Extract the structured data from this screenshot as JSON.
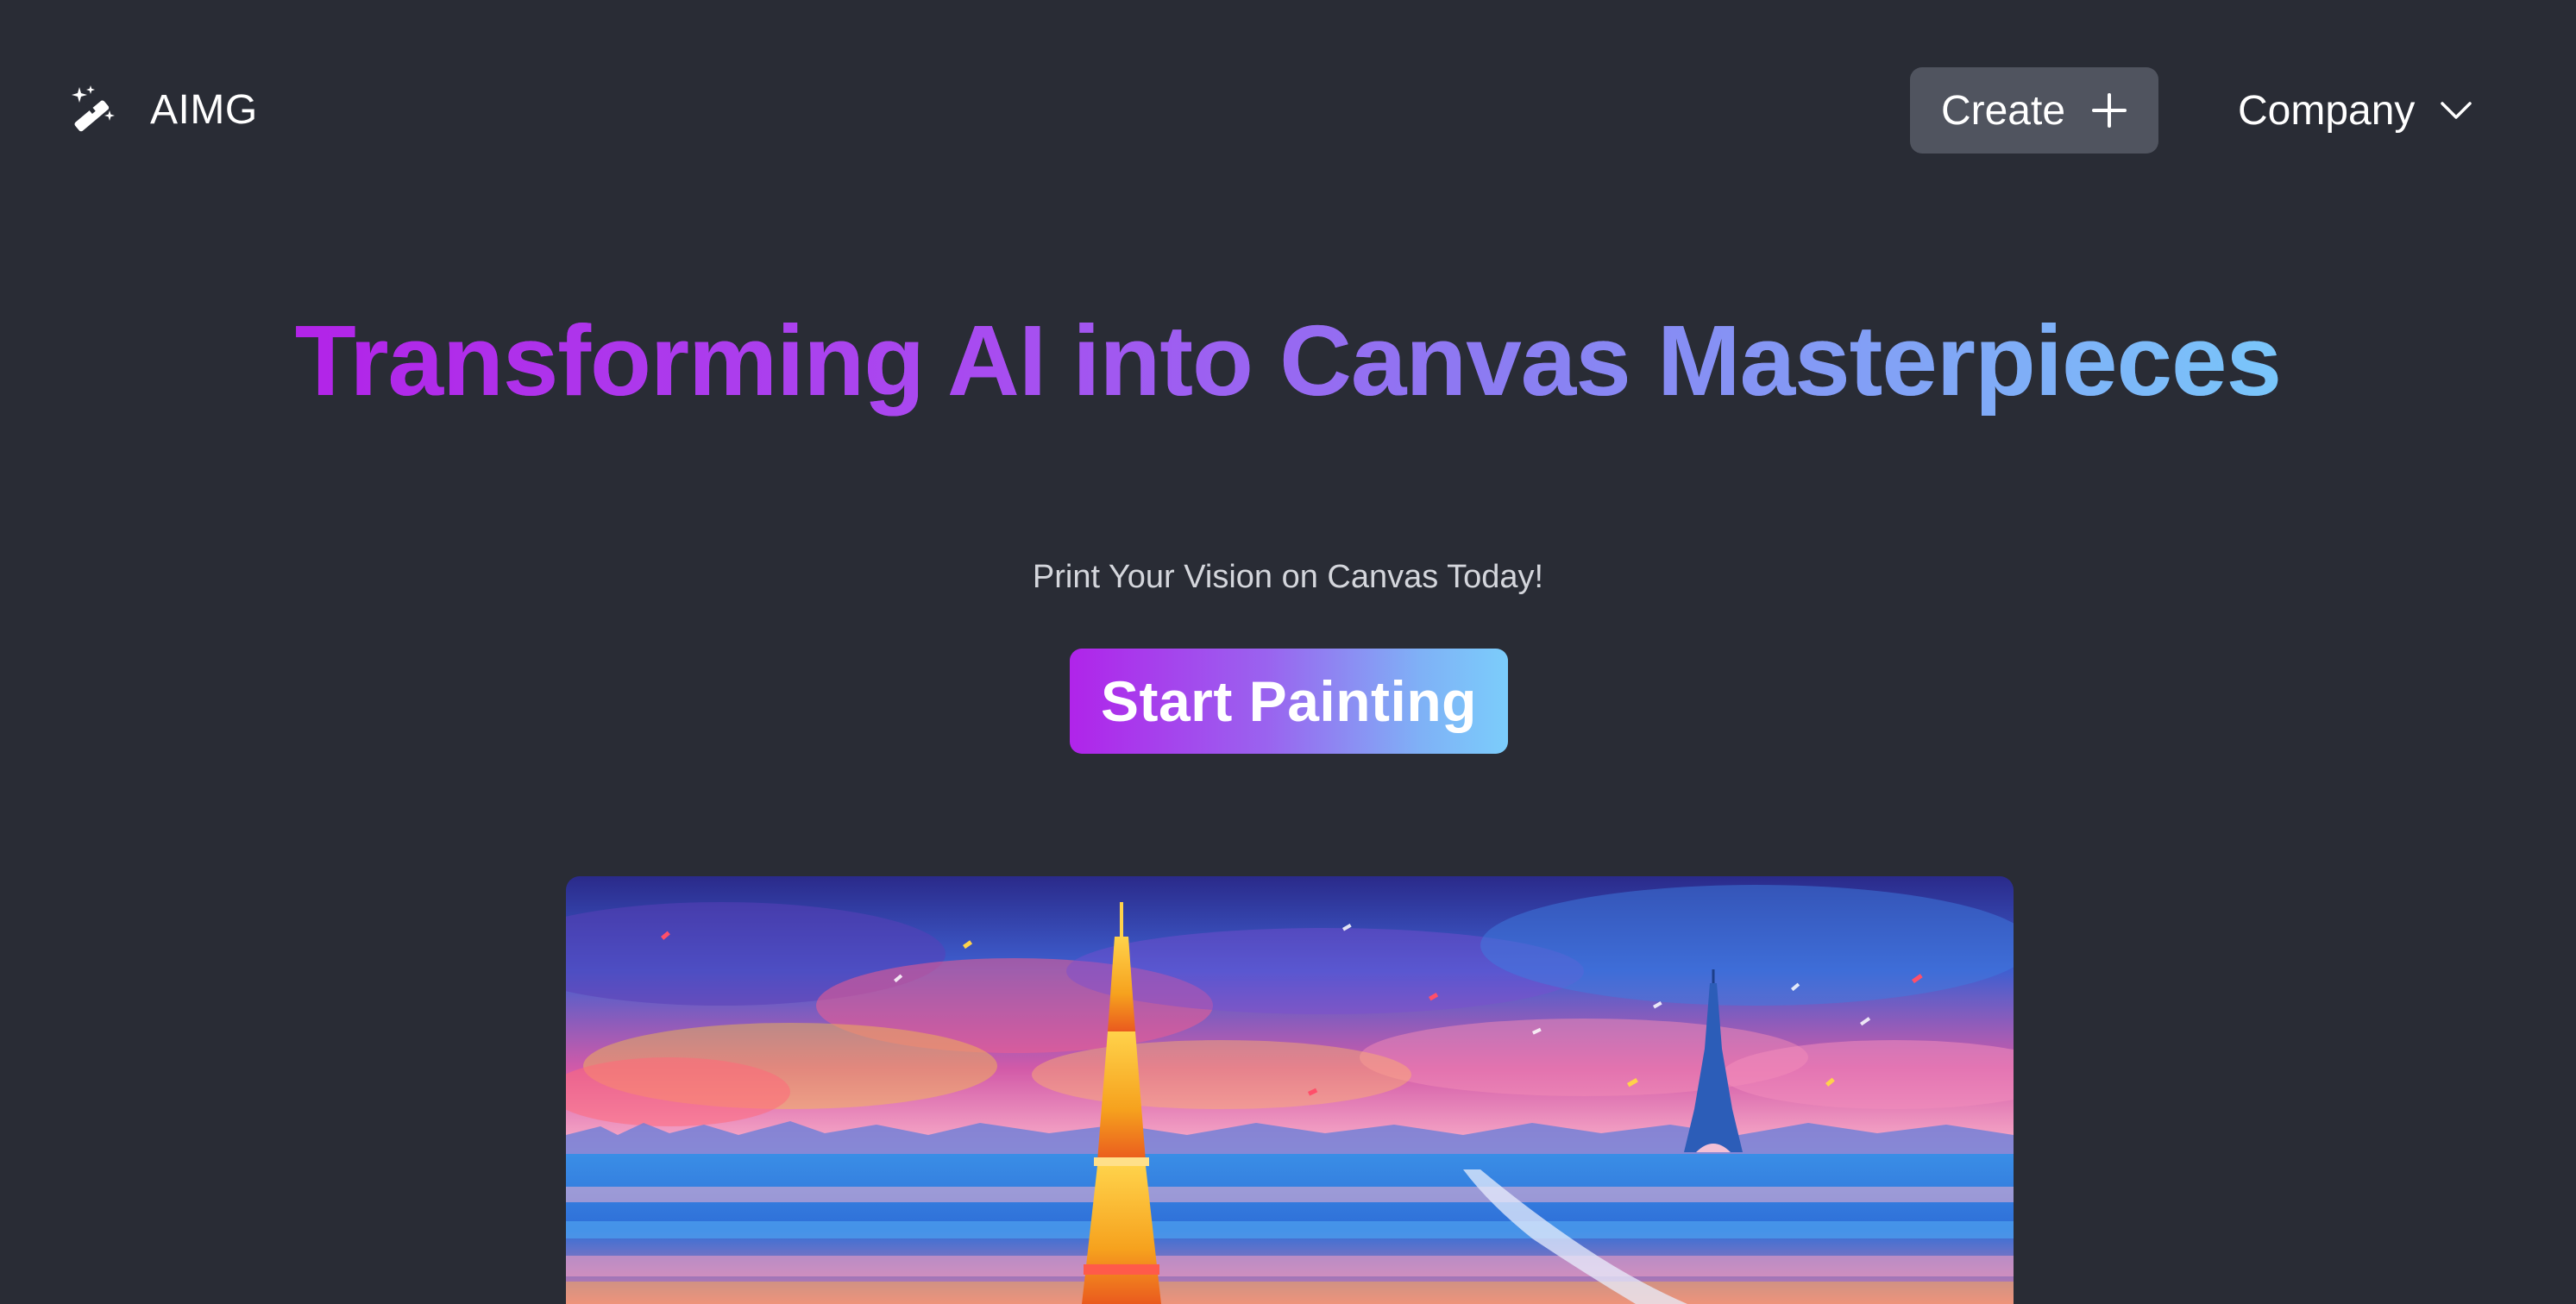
{
  "header": {
    "logo_text": "AIMG",
    "logo_icon": "magic-wand-icon",
    "create_label": "Create",
    "create_icon": "plus-icon",
    "company_label": "Company",
    "company_icon": "chevron-down-icon"
  },
  "hero": {
    "title": "Transforming AI into Canvas Masterpieces",
    "subtitle": "Print Your Vision on Canvas Today!",
    "cta_label": "Start Painting"
  },
  "showcase": {
    "image_subject": "painting-eiffel-tower-icon"
  },
  "colors": {
    "background": "#292c35",
    "create_button": "#50545f",
    "gradient_start": "#b223e8",
    "gradient_end": "#79c7fa"
  }
}
